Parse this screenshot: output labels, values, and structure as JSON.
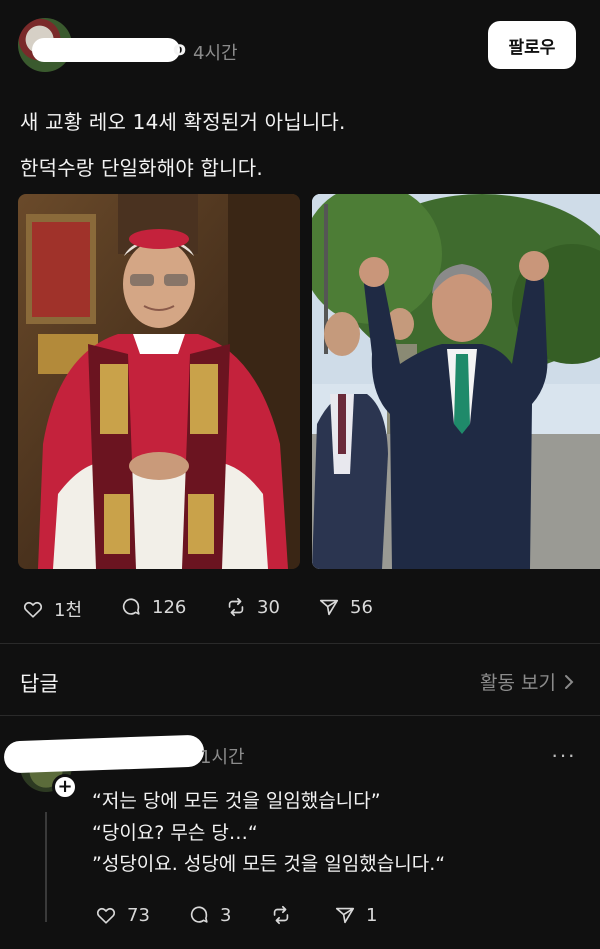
{
  "post": {
    "username_suffix": "o",
    "time": "4시간",
    "follow_label": "팔로우",
    "text_line1": "새 교황 레오 14세 확정된거 아닙니다.",
    "text_line2": "한덕수랑 단일화해야 합니다.",
    "images": [
      "pope-photo",
      "politician-photo"
    ],
    "actions": {
      "likes": "1천",
      "comments": "126",
      "reposts": "30",
      "shares": "56"
    }
  },
  "replies_section": {
    "label": "답글",
    "activity_link": "활동 보기"
  },
  "reply": {
    "time": "1시간",
    "more_label": "···",
    "add_label": "+",
    "lines": [
      "“저는 당에 모든 것을 일임했습니다”",
      "“당이요?  무슨 당…“",
      "”성당이요. 성당에 모든 것을 일임했습니다.“"
    ],
    "actions": {
      "likes": "73",
      "comments": "3",
      "reposts": "",
      "shares": "1"
    }
  },
  "colors": {
    "background": "#101010",
    "text": "#f3f3f3",
    "muted": "#8b8b8b",
    "divider": "#2a2a2a"
  }
}
